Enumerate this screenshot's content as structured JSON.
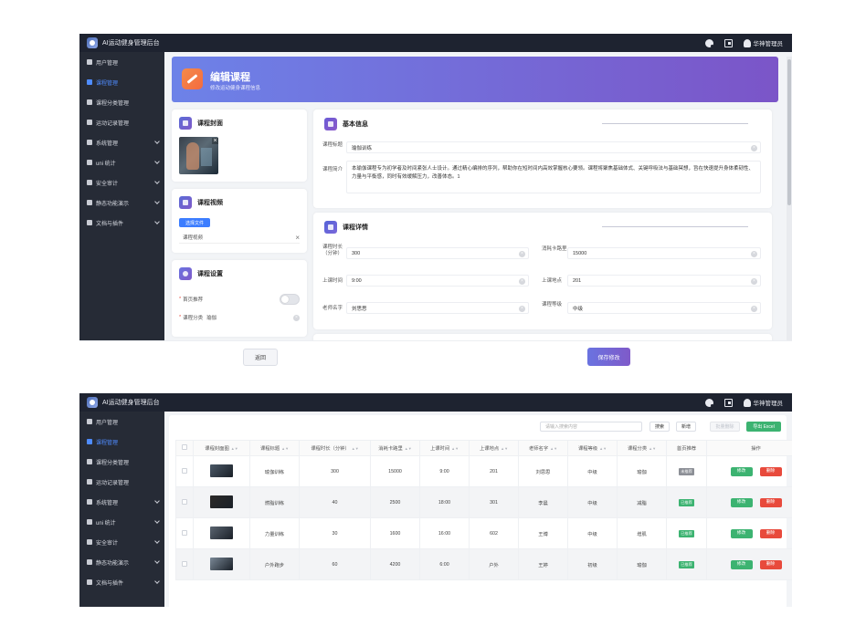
{
  "app": {
    "title": "AI运动健身管理后台",
    "user": "华神管理员"
  },
  "sidebar": [
    {
      "label": "用户管理",
      "active": false,
      "expandable": false,
      "icon": "user-icon"
    },
    {
      "label": "课程管理",
      "active": true,
      "expandable": false,
      "icon": "send-icon"
    },
    {
      "label": "课程分类管理",
      "active": false,
      "expandable": false,
      "icon": "list-icon"
    },
    {
      "label": "运动记录管理",
      "active": false,
      "expandable": false,
      "icon": "flag-icon"
    },
    {
      "label": "系统管理",
      "active": false,
      "expandable": true,
      "icon": "gear-icon"
    },
    {
      "label": "uni 统计",
      "active": false,
      "expandable": true,
      "icon": "chart-icon"
    },
    {
      "label": "安全审计",
      "active": false,
      "expandable": true,
      "icon": "shield-icon"
    },
    {
      "label": "静态功能演示",
      "active": false,
      "expandable": true,
      "icon": "grid-icon"
    },
    {
      "label": "文档与插件",
      "active": false,
      "expandable": true,
      "icon": "plugin-icon"
    }
  ],
  "edit": {
    "title": "编辑课程",
    "subtitle": "修改运动健身课程信息",
    "cover": {
      "title": "课程封面"
    },
    "video": {
      "title": "课程视频",
      "choose_label": "选择文件",
      "value": "课程视频"
    },
    "settings": {
      "title": "课程设置",
      "home_label": "首页推荐",
      "home_on": false,
      "category_label": "课程分类",
      "category_value": "瑜伽"
    },
    "basic": {
      "title": "基本信息",
      "name_label": "课程标题",
      "name_value": "瑜伽训练",
      "intro_label": "课程简介",
      "intro_value": "本瑜伽课程专为初学者及时间紧张人士设计。通过精心编排的序列，帮助你在短时间内高效掌握核心要领。课程将聚焦基础体式、关键呼吸法与基础冥想，旨在快速提升身体柔韧性、力量与平衡感，同时有效缓解压力，改善体态。1"
    },
    "details": {
      "title": "课程详情",
      "duration_label": "课程时长（分钟）",
      "duration_value": "300",
      "calories_label": "消耗卡路里",
      "calories_value": "15000",
      "time_label": "上课时间",
      "time_value": "9:00",
      "location_label": "上课地点",
      "location_value": "201",
      "teacher_label": "老师名字",
      "teacher_value": "刘思思",
      "level_label": "课程等级",
      "level_value": "中级"
    },
    "back_label": "返回",
    "save_label": "保存修改"
  },
  "list": {
    "search_placeholder": "请输入搜索内容",
    "search_label": "搜索",
    "add_label": "新增",
    "batch_delete_label": "批量删除",
    "export_label": "导出 Excel",
    "columns": [
      "课程封面图",
      "课程标题",
      "课程时长（分钟）",
      "消耗卡路里",
      "上课时间",
      "上课地点",
      "老师名字",
      "课程等级",
      "课程分类",
      "首页推荐",
      "操作"
    ],
    "edit_label": "修改",
    "delete_label": "删除",
    "rows": [
      {
        "title": "瑜伽训练",
        "duration": "300",
        "calories": "15000",
        "time": "9:00",
        "location": "201",
        "teacher": "刘思思",
        "level": "中级",
        "category": "瑜伽",
        "recommend": "未推荐",
        "recommend_on": false,
        "thumb_color": "#4a5866"
      },
      {
        "title": "燃脂训练",
        "duration": "40",
        "calories": "2500",
        "time": "18:00",
        "location": "301",
        "teacher": "李晨",
        "level": "中级",
        "category": "减脂",
        "recommend": "已推荐",
        "recommend_on": true,
        "thumb_color": "#2c2a28"
      },
      {
        "title": "力量训练",
        "duration": "30",
        "calories": "1600",
        "time": "16:00",
        "location": "602",
        "teacher": "王博",
        "level": "中级",
        "category": "增肌",
        "recommend": "已推荐",
        "recommend_on": true,
        "thumb_color": "#5a6470"
      },
      {
        "title": "户外跑步",
        "duration": "60",
        "calories": "4200",
        "time": "6:00",
        "location": "户外",
        "teacher": "王婷",
        "level": "初级",
        "category": "瑜伽",
        "recommend": "已推荐",
        "recommend_on": true,
        "thumb_color": "#7a8896"
      }
    ]
  }
}
